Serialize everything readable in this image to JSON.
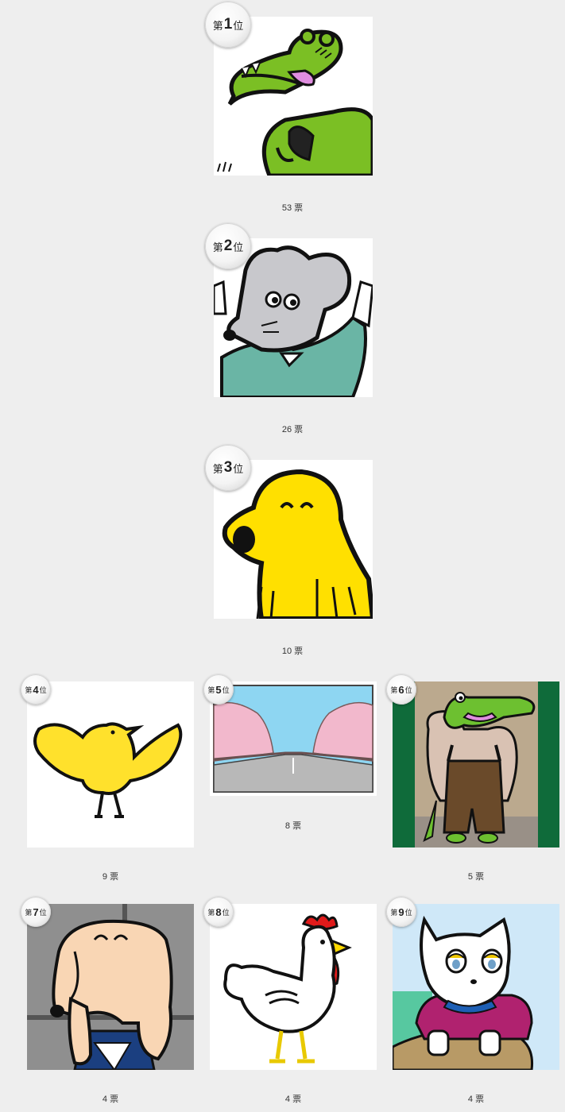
{
  "rank_prefix": "第",
  "rank_suffix": "位",
  "entries": [
    {
      "rank": "1",
      "votes": "53 票",
      "character": "crocodile-with-phone"
    },
    {
      "rank": "2",
      "votes": "26 票",
      "character": "gray-mouse"
    },
    {
      "rank": "3",
      "votes": "10 票",
      "character": "yellow-creature"
    },
    {
      "rank": "4",
      "votes": "9 票",
      "character": "yellow-bird"
    },
    {
      "rank": "5",
      "votes": "8 票",
      "character": "cherry-blossom-road"
    },
    {
      "rank": "6",
      "votes": "5 票",
      "character": "crocodile-in-overalls"
    },
    {
      "rank": "7",
      "votes": "4 票",
      "character": "beige-dog"
    },
    {
      "rank": "8",
      "votes": "4 票",
      "character": "white-rooster"
    },
    {
      "rank": "9",
      "votes": "4 票",
      "character": "white-cat"
    }
  ],
  "colors": {
    "background": "#eeeeee",
    "crocodile_green": "#7bbf24",
    "mouse_gray": "#c8c8cc",
    "shirt_teal": "#6ab5a5",
    "yellow": "#ffe000",
    "bird_yellow": "#ffe12c",
    "dog_beige": "#f9d6b4",
    "rooster_red": "#e01a1a",
    "cat_bg_blue": "#cfe8f8"
  }
}
